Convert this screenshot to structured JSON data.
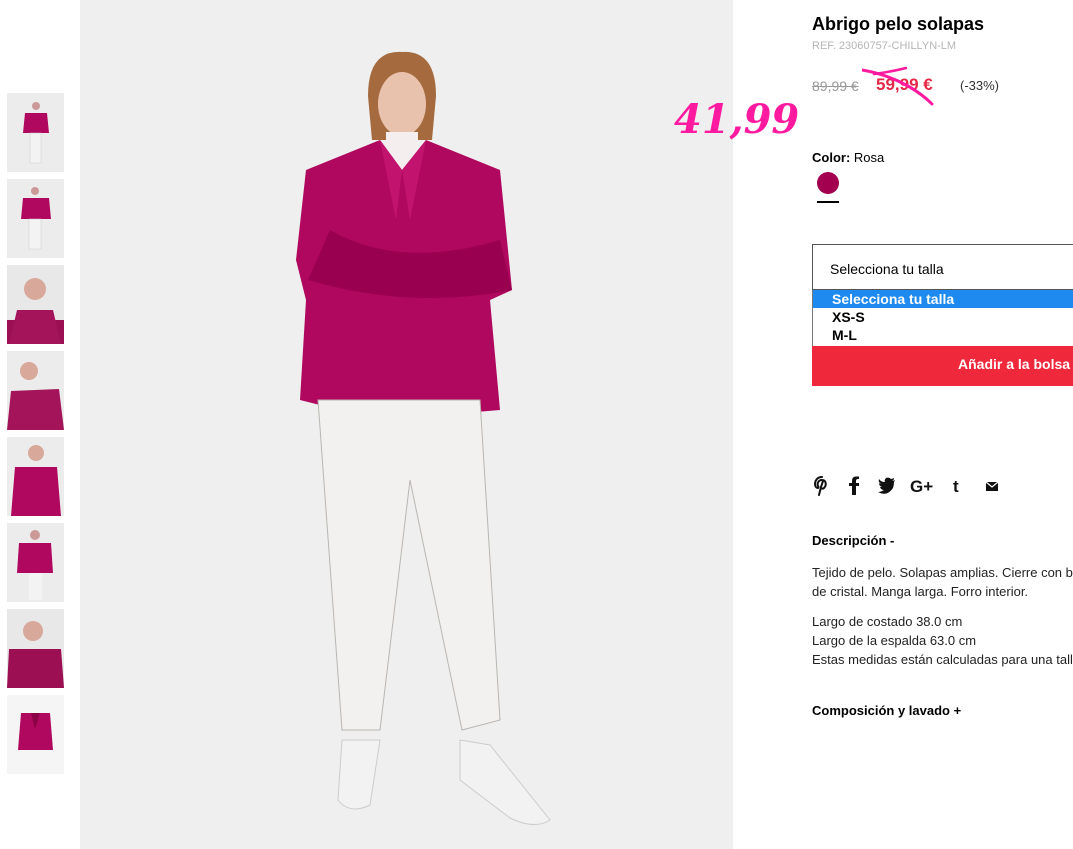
{
  "product": {
    "title": "Abrigo pelo solapas",
    "ref": "REF. 23060757-CHILLYN-LM",
    "old_price": "89,99 €",
    "sale_price": "59,99 €",
    "discount": "(-33%)",
    "handwritten_price": "41,99",
    "color_label": "Color:",
    "color_value": "Rosa",
    "color_hex": "#a3004f"
  },
  "size_select": {
    "current": "Selecciona tu talla",
    "options": [
      "Selecciona tu talla",
      "XS-S",
      "M-L"
    ],
    "selected_index": 0
  },
  "add_button": "Añadir a la bolsa",
  "social_icons": [
    "pinterest-icon",
    "facebook-icon",
    "twitter-icon",
    "google-plus-icon",
    "tumblr-icon",
    "email-icon"
  ],
  "description": {
    "heading": "Descripción -",
    "text": "Tejido de pelo. Solapas amplias. Cierre con botón de cristal. Manga larga. Forro interior.",
    "measures": [
      "Largo de costado 38.0 cm",
      "Largo de la espalda 63.0 cm",
      "Estas medidas están calculadas para una talla"
    ]
  },
  "composition": {
    "heading": "Composición y lavado +"
  },
  "colors": {
    "accent_red": "#f0283c",
    "sale_red": "#e52845",
    "handwritten_pink": "#ff1aa0",
    "option_highlight": "#1e8af0"
  }
}
